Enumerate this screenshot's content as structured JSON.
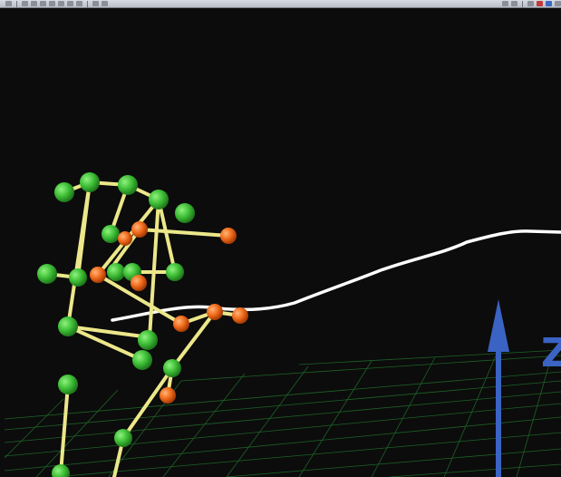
{
  "toolbar": {
    "buttons": [
      "view-icon",
      "select-icon",
      "move-icon",
      "rotate-icon",
      "scale-icon",
      "camera-icon",
      "light-icon",
      "grid-icon",
      "play-icon",
      "record-icon",
      "marker-icon",
      "skeleton-icon",
      "zoom-icon",
      "render-icon",
      "settings-icon"
    ]
  },
  "viewport": {
    "axis_label": "Z",
    "colors": {
      "background": "#0c0c0c",
      "grid": "#1f6b2a",
      "joint_green": "#3fbf37",
      "joint_orange": "#f06a1a",
      "bone": "#ece78a",
      "trajectory": "#ffffff",
      "axis": "#3a63c4"
    }
  }
}
